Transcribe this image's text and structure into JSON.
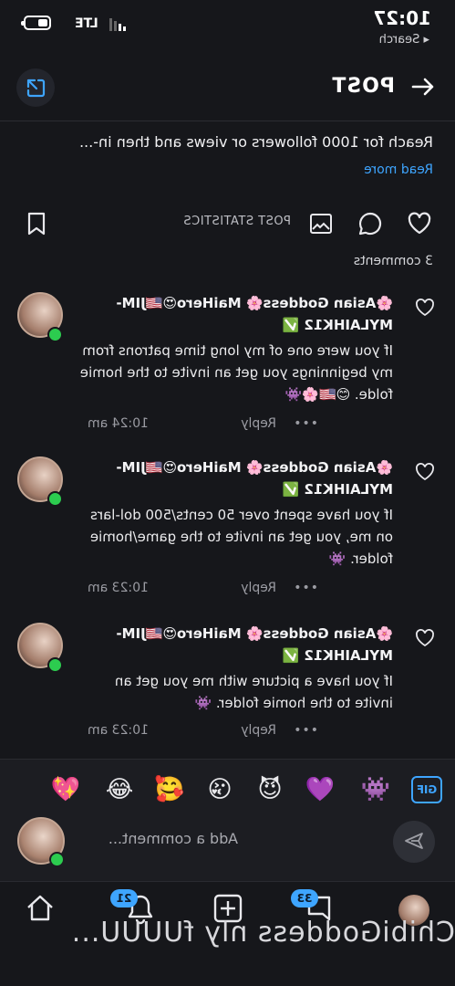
{
  "status_bar": {
    "time": "10:27",
    "back_label": "◂ Search",
    "network": "LTE"
  },
  "header": {
    "title": "POST"
  },
  "post": {
    "description": "Reach for 1000 followers or views and then in-...",
    "read_more": "Read more",
    "stats_label": "POST STATISTICS",
    "comments_count": "3 comments"
  },
  "comments": [
    {
      "author": "🌸Asian Goddess🌸 MaiHero😍🇺🇸JIM-MYLAIHK12 ✅",
      "text": "If you were one of my long time patrons from my beginnings you get an invite to the homie folde. 😊🇺🇸🌸👾",
      "time": "10:24 am",
      "reply": "Reply",
      "more": "•••"
    },
    {
      "author": "🌸Asian Goddess🌸 MaiHero😍🇺🇸JIM-MYLAIHK12 ✅",
      "text": "If you have spent over 50 cents/500 dol-lars on me, you get an invite to the game/homie folder. 👾",
      "time": "10:23 am",
      "reply": "Reply",
      "more": "•••"
    },
    {
      "author": "🌸Asian Goddess🌸 MaiHero😍🇺🇸JIM-MYLAIHK12 ✅",
      "text": "If you have a picture with me you get an invite to the homie folder. 👾",
      "time": "10:23 am",
      "reply": "Reply",
      "more": "•••"
    }
  ],
  "emoji_bar": {
    "gif_label": "GIF",
    "emojis": [
      "👾",
      "💜",
      "😈",
      "😘",
      "🥰",
      "😂",
      "💖"
    ]
  },
  "comment_input": {
    "placeholder": "Add a comment..."
  },
  "nav": {
    "messages_badge": "33",
    "notifications_badge": "21",
    "footer_text": "ChibiGoddess nly fUUUU..."
  },
  "colors": {
    "background": "#16171b",
    "accent": "#3ea5ff",
    "online": "#2ccc4f"
  }
}
